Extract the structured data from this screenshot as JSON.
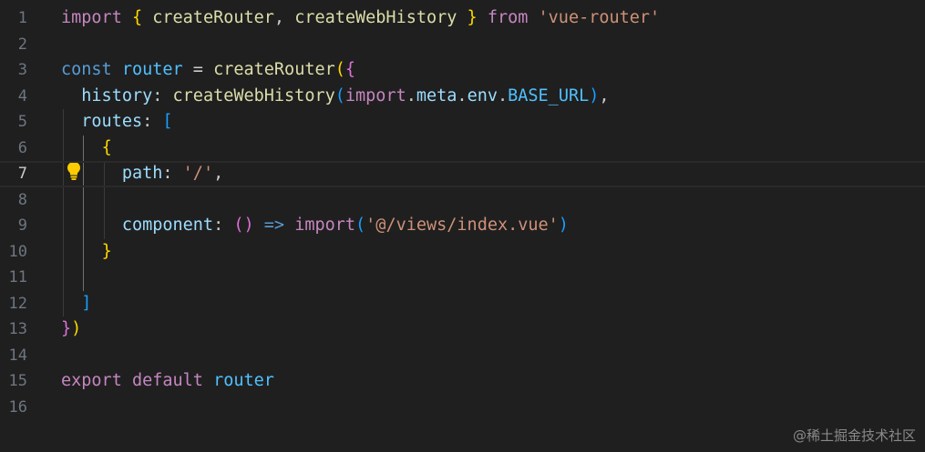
{
  "editor": {
    "active_line": 7,
    "lines": [
      {
        "n": "1",
        "tokens": [
          [
            "import",
            "kw"
          ],
          [
            " ",
            ""
          ],
          [
            "{",
            "b1"
          ],
          [
            " ",
            ""
          ],
          [
            "createRouter",
            "fn"
          ],
          [
            ", ",
            "punc"
          ],
          [
            "createWebHistory",
            "fn"
          ],
          [
            " ",
            ""
          ],
          [
            "}",
            "b1"
          ],
          [
            " ",
            ""
          ],
          [
            "from",
            "kw"
          ],
          [
            " ",
            ""
          ],
          [
            "'vue-router'",
            "str"
          ]
        ]
      },
      {
        "n": "2",
        "tokens": []
      },
      {
        "n": "3",
        "tokens": [
          [
            "const",
            "def"
          ],
          [
            " ",
            ""
          ],
          [
            "router",
            "var"
          ],
          [
            " = ",
            "punc"
          ],
          [
            "createRouter",
            "fn"
          ],
          [
            "(",
            "b1"
          ],
          [
            "{",
            "b2"
          ]
        ]
      },
      {
        "n": "4",
        "tokens": [
          [
            "  ",
            ""
          ],
          [
            "history",
            "prop"
          ],
          [
            ": ",
            "punc"
          ],
          [
            "createWebHistory",
            "fn"
          ],
          [
            "(",
            "b3"
          ],
          [
            "import",
            "kw"
          ],
          [
            ".",
            "punc"
          ],
          [
            "meta",
            "prop"
          ],
          [
            ".",
            "punc"
          ],
          [
            "env",
            "prop"
          ],
          [
            ".",
            "punc"
          ],
          [
            "BASE_URL",
            "var"
          ],
          [
            ")",
            "b3"
          ],
          [
            ",",
            "punc"
          ]
        ]
      },
      {
        "n": "5",
        "tokens": [
          [
            "  ",
            ""
          ],
          [
            "routes",
            "prop"
          ],
          [
            ": ",
            "punc"
          ],
          [
            "[",
            "b3"
          ]
        ]
      },
      {
        "n": "6",
        "tokens": [
          [
            "    ",
            ""
          ],
          [
            "{",
            "b1"
          ]
        ]
      },
      {
        "n": "7",
        "tokens": [
          [
            "      ",
            ""
          ],
          [
            "path",
            "prop"
          ],
          [
            ": ",
            "punc"
          ],
          [
            "'/'",
            "str"
          ],
          [
            ",",
            "punc"
          ]
        ]
      },
      {
        "n": "8",
        "tokens": []
      },
      {
        "n": "9",
        "tokens": [
          [
            "      ",
            ""
          ],
          [
            "component",
            "prop"
          ],
          [
            ": ",
            "punc"
          ],
          [
            "()",
            "b2"
          ],
          [
            " ",
            ""
          ],
          [
            "=>",
            "def"
          ],
          [
            " ",
            ""
          ],
          [
            "import",
            "kw"
          ],
          [
            "(",
            "b3"
          ],
          [
            "'@/views/index.vue'",
            "str"
          ],
          [
            ")",
            "b3"
          ]
        ]
      },
      {
        "n": "10",
        "tokens": [
          [
            "    ",
            ""
          ],
          [
            "}",
            "b1"
          ]
        ]
      },
      {
        "n": "11",
        "tokens": []
      },
      {
        "n": "12",
        "tokens": [
          [
            "  ",
            ""
          ],
          [
            "]",
            "b3"
          ]
        ]
      },
      {
        "n": "13",
        "tokens": [
          [
            "}",
            "b2"
          ],
          [
            ")",
            "b1"
          ]
        ]
      },
      {
        "n": "14",
        "tokens": []
      },
      {
        "n": "15",
        "tokens": [
          [
            "export",
            "kw"
          ],
          [
            " ",
            ""
          ],
          [
            "default",
            "kw"
          ],
          [
            " ",
            ""
          ],
          [
            "router",
            "var"
          ]
        ]
      },
      {
        "n": "16",
        "tokens": []
      }
    ]
  },
  "lightbulb_icon": "lightbulb-icon",
  "watermark": "@稀土掘金技术社区",
  "colors": {
    "background": "#1f1f1f",
    "keyword": "#c586c0",
    "function": "#dcdcaa",
    "string": "#ce9178",
    "variable": "#4fc1ff",
    "property": "#9cdcfe",
    "bracket_gold": "#ffd700",
    "bracket_orchid": "#da70d6",
    "bracket_blue": "#179fff",
    "bulb": "#ffcc00"
  }
}
